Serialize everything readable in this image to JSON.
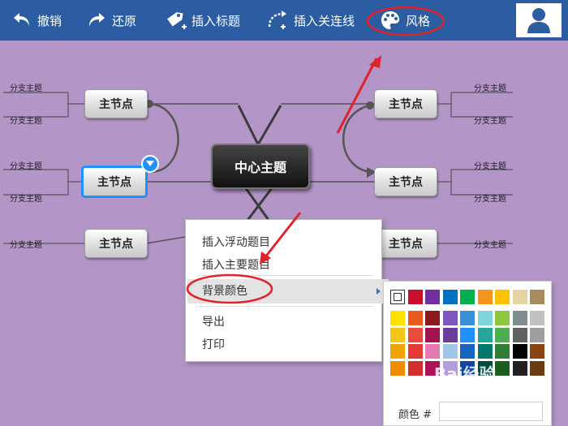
{
  "toolbar": {
    "undo_label": "撤销",
    "redo_label": "还原",
    "insert_title_label": "插入标题",
    "insert_link_label": "插入关连线",
    "style_label": "风格",
    "undo_icon": "undo-icon",
    "redo_icon": "redo-icon",
    "insert_title_icon": "tag-plus-icon",
    "insert_link_icon": "curve-plus-icon",
    "style_icon": "palette-icon",
    "user_icon": "user-icon"
  },
  "mindmap": {
    "center_label": "中心主题",
    "main_node_label": "主节点",
    "branch_label": "分支主题"
  },
  "context_menu": {
    "items": [
      "插入浮动题目",
      "插入主要题目",
      "背景颜色",
      "导出",
      "打印"
    ],
    "submenu_arrow_icon": "chevron-right-icon"
  },
  "color_palette": {
    "color_label": "颜色",
    "hash_symbol": "#",
    "input_value": "",
    "colors": [
      [
        "#ffffff",
        "#c8102e",
        "#7030a0",
        "#0070c0",
        "#00b050",
        "#f7941d",
        "#ffc000",
        "#e6d3a3",
        "#a78c5f"
      ],
      [
        "#ffe100",
        "#e85a1e",
        "#8b1a1a",
        "#7e57c2",
        "#3a8fd9",
        "#7fd3d9",
        "#8dc63f",
        "#7f8c8d",
        "#c0c0c0"
      ],
      [
        "#f5c518",
        "#e84c3d",
        "#a0144f",
        "#6a3d9a",
        "#1e90ff",
        "#26a69a",
        "#4caf50",
        "#616161",
        "#9e9e9e"
      ],
      [
        "#f0a500",
        "#e53935",
        "#e57ab2",
        "#9fc5e8",
        "#1565c0",
        "#00796b",
        "#2e7d32",
        "#000000",
        "#8b4513"
      ],
      [
        "#f08c00",
        "#d32f2f",
        "#ad1457",
        "#b39ddb",
        "#0d47a1",
        "#004d40",
        "#1b5e20",
        "#212121",
        "#6d3b12"
      ]
    ]
  },
  "annotation_color": "#e0222a",
  "watermark": "Bai经验"
}
